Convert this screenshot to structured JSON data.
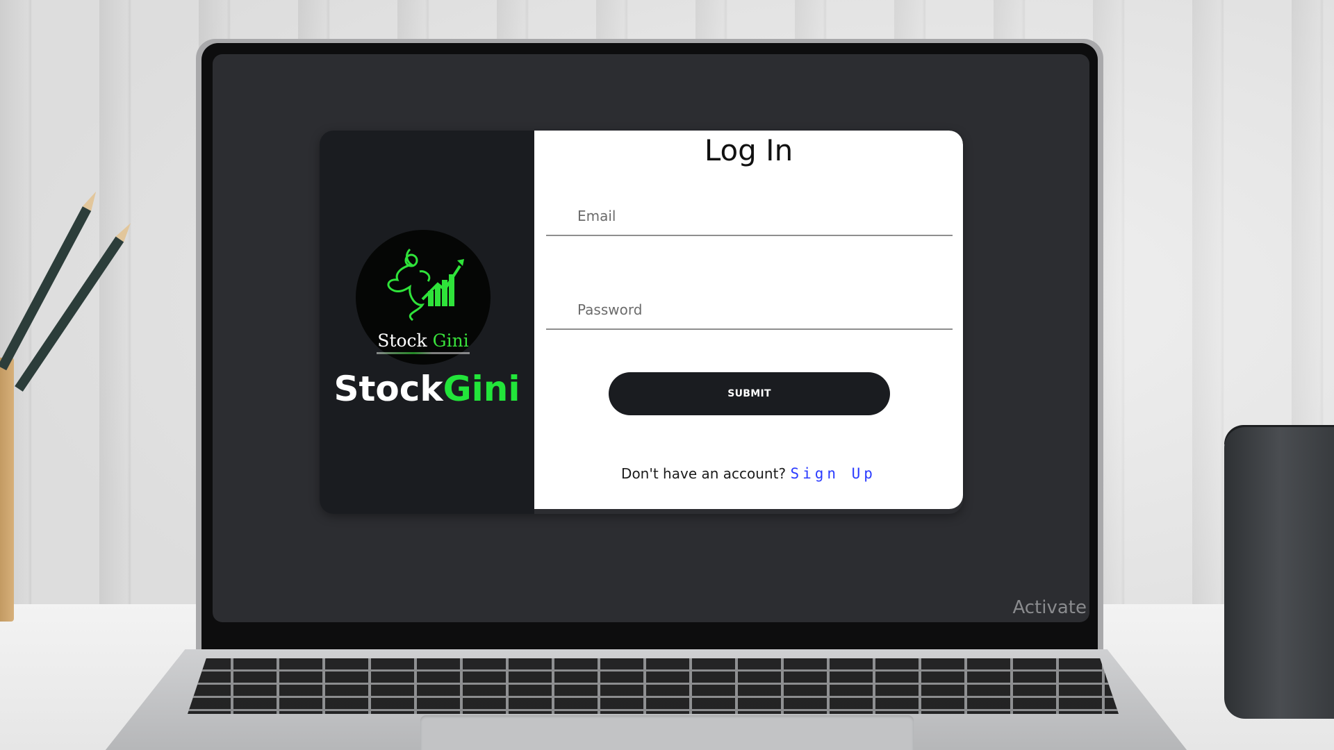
{
  "brand": {
    "logo_text_primary": "Stock",
    "logo_text_accent": "Gini",
    "name_primary": "Stock",
    "name_accent": "Gini",
    "accent_color": "#22e53a"
  },
  "login": {
    "title": "Log In",
    "email_placeholder": "Email",
    "password_placeholder": "Password",
    "submit_label": "SUBMIT",
    "signup_prompt": "Don't have an account?",
    "signup_link": "Sign Up"
  },
  "os_watermark": "Activate",
  "icons": {
    "logo": "genie-rocket-chart-logo"
  }
}
